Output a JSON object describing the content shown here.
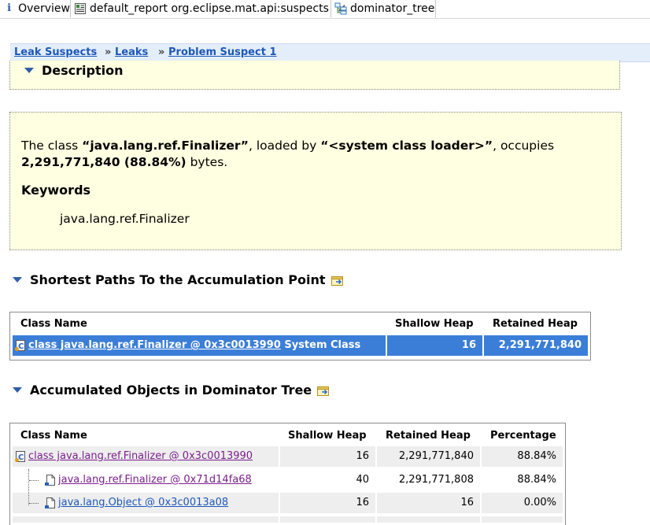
{
  "tabs": [
    {
      "label": "Overview",
      "icon": "info-icon"
    },
    {
      "label": "default_report org.eclipse.mat.api:suspects",
      "icon": "report-icon",
      "close": "✕"
    },
    {
      "label": "dominator_tree",
      "icon": "tree-icon"
    }
  ],
  "breadcrumb": {
    "items": [
      "Leak Suspects",
      "Leaks",
      "Problem Suspect 1"
    ],
    "separator": "»"
  },
  "description": {
    "title": "Description",
    "text_prefix": "The class ",
    "class_name": "“java.lang.ref.Finalizer”",
    "text_mid": ", loaded by ",
    "loader": "“<system class loader>”",
    "text_mid2": ", occupies ",
    "bytes": "2,291,771,840 (88.84%)",
    "text_suffix": " bytes.",
    "keywords_title": "Keywords",
    "keyword": "java.lang.ref.Finalizer"
  },
  "shortest_paths": {
    "title": "Shortest Paths To the Accumulation Point",
    "headers": [
      "Class Name",
      "Shallow Heap",
      "Retained Heap"
    ],
    "row": {
      "link": "class java.lang.ref.Finalizer @ 0x3c0013990",
      "suffix": " System Class",
      "shallow": "16",
      "retained": "2,291,771,840"
    }
  },
  "dominator": {
    "title": "Accumulated Objects in Dominator Tree",
    "headers": [
      "Class Name",
      "Shallow Heap",
      "Retained Heap",
      "Percentage"
    ],
    "rows": [
      {
        "name": "class java.lang.ref.Finalizer @ 0x3c0013990",
        "shallow": "16",
        "retained": "2,291,771,840",
        "pct": "88.84%"
      },
      {
        "name": "java.lang.ref.Finalizer @ 0x71d14fa68",
        "shallow": "40",
        "retained": "2,291,771,808",
        "pct": "88.84%"
      },
      {
        "name": "java.lang.Object @ 0x3c0013a08",
        "shallow": "16",
        "retained": "16",
        "pct": "0.00%"
      }
    ]
  },
  "colors": {
    "highlight": "#3b7ed8",
    "yellow_panel": "#ffffe1",
    "link_blue": "#1d58b8",
    "link_visited": "#7a1f8c"
  }
}
